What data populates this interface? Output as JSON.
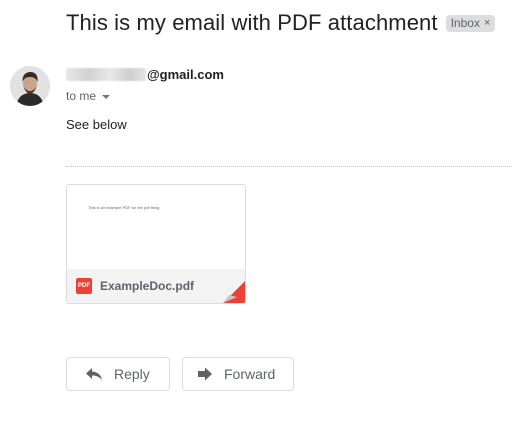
{
  "email": {
    "subject": "This is my email with PDF attachment",
    "label_badge": "Inbox",
    "label_remove_glyph": "×",
    "sender_domain": "@gmail.com",
    "recipient_line": "to me",
    "body": "See below"
  },
  "attachment": {
    "filename": "ExampleDoc.pdf",
    "type_label": "PDF",
    "preview_text": "This is an example PDF for the pdf thing"
  },
  "actions": {
    "reply_label": "Reply",
    "forward_label": "Forward"
  },
  "icons": {
    "label_remove": "close-icon",
    "recipient_details": "caret-down-icon",
    "file_type": "pdf-icon",
    "reply": "reply-arrow-icon",
    "forward": "forward-arrow-icon"
  },
  "colors": {
    "pdf_red": "#ea4335",
    "badge_bg": "#dddddd",
    "text_primary": "#202124",
    "text_secondary": "#5f6368"
  }
}
